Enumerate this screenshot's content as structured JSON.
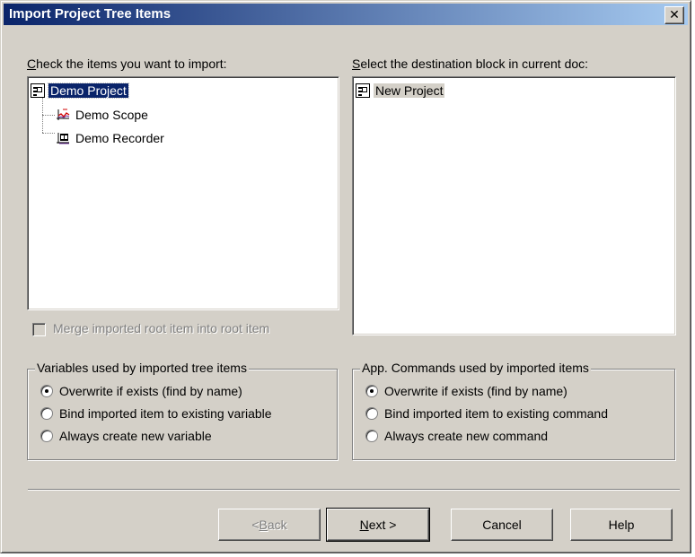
{
  "window": {
    "title": "Import Project Tree Items",
    "close_symbol": "✕"
  },
  "left_panel": {
    "label_first": "C",
    "label_rest": "heck the items you want to import:",
    "tree": [
      {
        "label": "Demo Project",
        "icon": "project-icon"
      },
      {
        "label": "Demo Scope",
        "icon": "scope-icon"
      },
      {
        "label": "Demo Recorder",
        "icon": "recorder-icon"
      }
    ],
    "merge_checkbox": {
      "label": "Merge imported root item into root item",
      "checked": false,
      "enabled": false
    }
  },
  "right_panel": {
    "label_first": "S",
    "label_rest": "elect the destination block in current doc:",
    "tree": [
      {
        "label": "New Project",
        "icon": "project-icon"
      }
    ]
  },
  "variables_group": {
    "title": "Variables used by imported tree items",
    "options": [
      {
        "label": "Overwrite if exists (find by name)",
        "selected": true
      },
      {
        "label": "Bind imported item to existing variable",
        "selected": false
      },
      {
        "label": "Always create new variable",
        "selected": false
      }
    ]
  },
  "commands_group": {
    "title": "App. Commands used by imported items",
    "options": [
      {
        "label": "Overwrite if exists (find by name)",
        "selected": true
      },
      {
        "label": "Bind imported item to existing command",
        "selected": false
      },
      {
        "label": "Always create new command",
        "selected": false
      }
    ]
  },
  "buttons": {
    "back_pre": "< ",
    "back_u": "B",
    "back_post": "ack",
    "next_u": "N",
    "next_post": "ext >",
    "cancel": "Cancel",
    "help": "Help"
  }
}
